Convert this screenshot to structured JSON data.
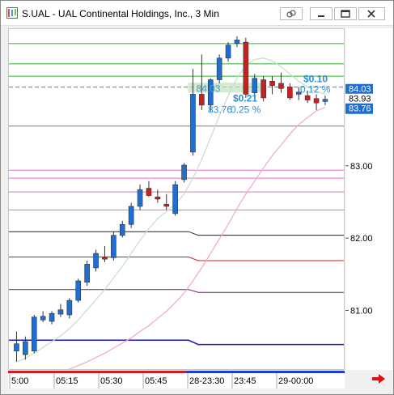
{
  "window": {
    "title": "S.UAL - UAL Continental Holdings, Inc., 3 Min",
    "icons": [
      "link-icon",
      "minimize-icon",
      "restore-icon",
      "close-icon"
    ]
  },
  "colors": {
    "up": "#1f6fd1",
    "down": "#cc1f1f",
    "sma_fast": "#c3e0c3",
    "sma_slow": "#f0a8c8",
    "label_blue": "#2a8fd8",
    "price_tag": "#1f6fd1"
  },
  "price_tags": {
    "top": "84.03",
    "mid": "83.93",
    "bottom": "83.76"
  },
  "annotations": {
    "last_change": "$0.10",
    "last_change_pct": "0.12 %",
    "overlay_price": "84.03",
    "move_change": "$0.21",
    "move_base": "83.76",
    "move_pct": "0.25 %"
  },
  "chart_data": {
    "type": "candlestick",
    "y_ticks": [
      "83.00",
      "82.00",
      "81.00"
    ],
    "y_range": [
      80.2,
      84.9
    ],
    "x_ticks": [
      "5:00",
      "05:15",
      "05:30",
      "05:45",
      "28-23:30",
      "23:45",
      "29-00:00"
    ],
    "candles": [
      {
        "o": 80.45,
        "h": 80.72,
        "l": 80.3,
        "c": 80.55
      },
      {
        "o": 80.4,
        "h": 80.65,
        "l": 80.33,
        "c": 80.58
      },
      {
        "o": 80.45,
        "h": 80.95,
        "l": 80.42,
        "c": 80.92
      },
      {
        "o": 80.88,
        "h": 81.0,
        "l": 80.85,
        "c": 80.93
      },
      {
        "o": 80.86,
        "h": 81.0,
        "l": 80.82,
        "c": 80.97
      },
      {
        "o": 80.96,
        "h": 81.1,
        "l": 80.92,
        "c": 81.02
      },
      {
        "o": 80.95,
        "h": 81.18,
        "l": 80.9,
        "c": 81.15
      },
      {
        "o": 81.15,
        "h": 81.45,
        "l": 81.12,
        "c": 81.42
      },
      {
        "o": 81.4,
        "h": 81.7,
        "l": 81.35,
        "c": 81.65
      },
      {
        "o": 81.6,
        "h": 81.85,
        "l": 81.55,
        "c": 81.8
      },
      {
        "o": 81.75,
        "h": 81.9,
        "l": 81.68,
        "c": 81.72
      },
      {
        "o": 81.74,
        "h": 82.1,
        "l": 81.7,
        "c": 82.05
      },
      {
        "o": 82.05,
        "h": 82.25,
        "l": 82.02,
        "c": 82.2
      },
      {
        "o": 82.2,
        "h": 82.5,
        "l": 82.15,
        "c": 82.45
      },
      {
        "o": 82.45,
        "h": 82.75,
        "l": 82.4,
        "c": 82.68
      },
      {
        "o": 82.7,
        "h": 82.8,
        "l": 82.58,
        "c": 82.6
      },
      {
        "o": 82.58,
        "h": 82.68,
        "l": 82.5,
        "c": 82.55
      },
      {
        "o": 82.48,
        "h": 82.62,
        "l": 82.4,
        "c": 82.45
      },
      {
        "o": 82.35,
        "h": 82.8,
        "l": 82.32,
        "c": 82.75
      },
      {
        "o": 82.82,
        "h": 83.05,
        "l": 82.78,
        "c": 83.02
      },
      {
        "o": 83.2,
        "h": 84.35,
        "l": 83.15,
        "c": 84.0
      },
      {
        "o": 84.0,
        "h": 84.55,
        "l": 83.78,
        "c": 83.85
      },
      {
        "o": 83.85,
        "h": 84.22,
        "l": 83.76,
        "c": 84.2
      },
      {
        "o": 84.2,
        "h": 84.55,
        "l": 84.15,
        "c": 84.5
      },
      {
        "o": 84.5,
        "h": 84.72,
        "l": 84.45,
        "c": 84.68
      },
      {
        "o": 84.7,
        "h": 84.8,
        "l": 84.65,
        "c": 84.75
      },
      {
        "o": 84.72,
        "h": 84.78,
        "l": 83.95,
        "c": 84.0
      },
      {
        "o": 84.02,
        "h": 84.28,
        "l": 83.95,
        "c": 84.22
      },
      {
        "o": 84.2,
        "h": 84.25,
        "l": 83.9,
        "c": 83.95
      },
      {
        "o": 84.18,
        "h": 84.25,
        "l": 84.0,
        "c": 84.12
      },
      {
        "o": 84.15,
        "h": 84.3,
        "l": 84.02,
        "c": 84.08
      },
      {
        "o": 84.1,
        "h": 84.15,
        "l": 83.92,
        "c": 83.95
      },
      {
        "o": 84.0,
        "h": 84.1,
        "l": 83.92,
        "c": 84.03
      },
      {
        "o": 83.98,
        "h": 84.05,
        "l": 83.88,
        "c": 83.92
      },
      {
        "o": 83.94,
        "h": 84.0,
        "l": 83.78,
        "c": 83.88
      },
      {
        "o": 83.9,
        "h": 83.98,
        "l": 83.85,
        "c": 83.93
      }
    ],
    "reference_levels": [
      {
        "pre": 84.7,
        "post": 84.7,
        "color": "#2db82d",
        "dash": false
      },
      {
        "pre": 84.42,
        "post": 84.42,
        "color": "#2db82d",
        "dash": false
      },
      {
        "pre": 84.25,
        "post": 84.25,
        "color": "#2db82d",
        "dash": false
      },
      {
        "pre": 84.1,
        "post": 84.1,
        "color": "#2db82d",
        "dash": true
      },
      {
        "pre": 83.56,
        "post": 83.56,
        "color": "#7a7a7a",
        "dash": false
      },
      {
        "pre": 82.95,
        "post": 82.95,
        "color": "#e070c0",
        "dash": false
      },
      {
        "pre": 82.84,
        "post": 82.84,
        "color": "#e070c0",
        "dash": false
      },
      {
        "pre": 82.65,
        "post": 82.65,
        "color": "#e070c0",
        "dash": false
      },
      {
        "pre": 82.4,
        "post": 82.4,
        "color": "#e070c0",
        "dash": false
      },
      {
        "pre": 82.1,
        "post": 82.05,
        "color": "#222222",
        "dash": false
      },
      {
        "pre": 81.75,
        "post": 81.7,
        "color": "#cc1f1f",
        "dash": false
      },
      {
        "pre": 81.3,
        "post": 81.26,
        "color": "#6a1f6a",
        "dash": false
      },
      {
        "pre": 80.6,
        "post": 80.54,
        "color": "#1a1ab8",
        "dash": false
      }
    ],
    "sma_fast": [
      80.3,
      80.35,
      80.42,
      80.5,
      80.58,
      80.66,
      80.76,
      80.88,
      81.02,
      81.16,
      81.3,
      81.46,
      81.62,
      81.8,
      81.98,
      82.14,
      82.28,
      82.38,
      82.48,
      82.62,
      82.84,
      83.1,
      83.4,
      83.7,
      83.98,
      84.22,
      84.4,
      84.48,
      84.5,
      84.46,
      84.38,
      84.28,
      84.18,
      84.1,
      84.04,
      84.0
    ],
    "sma_slow": [
      80.0,
      80.02,
      80.05,
      80.08,
      80.12,
      80.16,
      80.2,
      80.25,
      80.3,
      80.36,
      80.42,
      80.49,
      80.56,
      80.63,
      80.72,
      80.8,
      80.9,
      81.0,
      81.12,
      81.25,
      81.42,
      81.6,
      81.8,
      82.0,
      82.2,
      82.42,
      82.62,
      82.8,
      82.98,
      83.15,
      83.3,
      83.45,
      83.58,
      83.68,
      83.77,
      83.82
    ]
  }
}
